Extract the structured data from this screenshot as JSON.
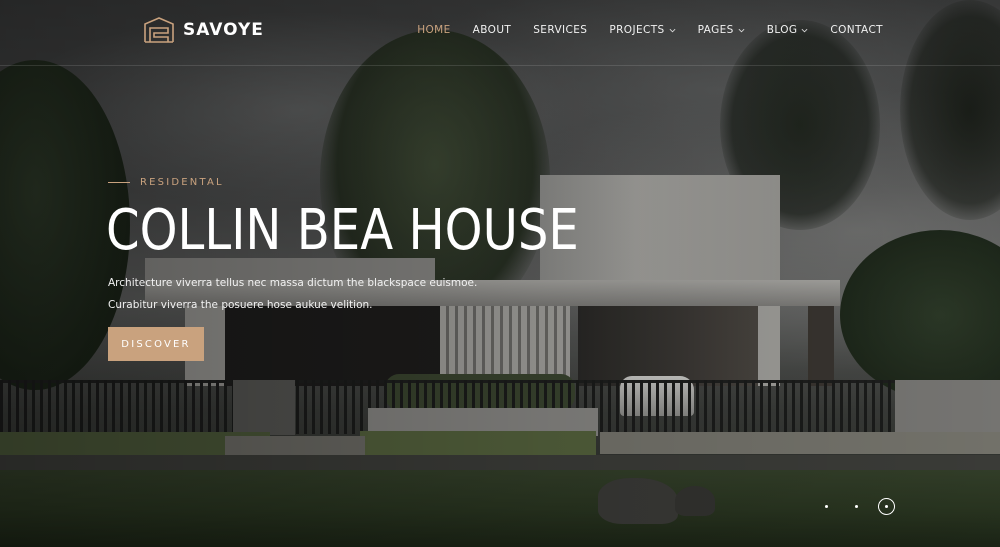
{
  "brand": {
    "name": "SAVOYE",
    "logo_icon": "building-icon"
  },
  "nav": {
    "items": [
      {
        "label": "HOME",
        "active": true,
        "dropdown": false
      },
      {
        "label": "ABOUT",
        "active": false,
        "dropdown": false
      },
      {
        "label": "SERVICES",
        "active": false,
        "dropdown": false
      },
      {
        "label": "PROJECTS",
        "active": false,
        "dropdown": true
      },
      {
        "label": "PAGES",
        "active": false,
        "dropdown": true
      },
      {
        "label": "BLOG",
        "active": false,
        "dropdown": true
      },
      {
        "label": "CONTACT",
        "active": false,
        "dropdown": false
      }
    ]
  },
  "hero": {
    "tagline": "RESIDENTAL",
    "title": "COLLIN BEA HOUSE",
    "description_line_1": "Architecture viverra tellus nec massa dictum the blackspace euismoe.",
    "description_line_2": "Curabitur viverra the posuere hose aukue velition.",
    "button_label": "DISCOVER"
  },
  "slider": {
    "total": 3,
    "active_index": 2
  },
  "colors": {
    "accent": "#c9a27e",
    "text": "#ffffff"
  }
}
